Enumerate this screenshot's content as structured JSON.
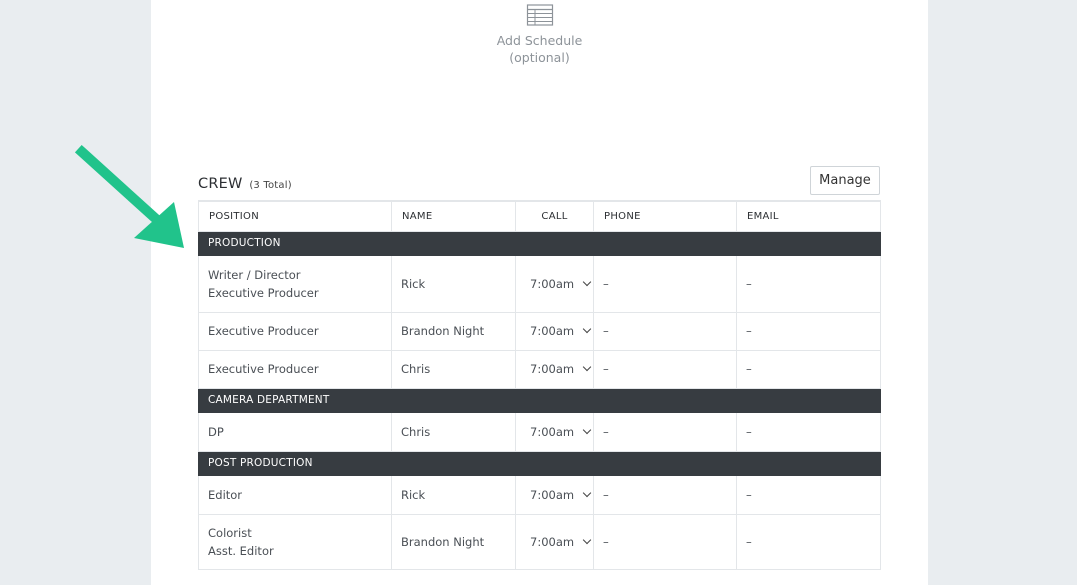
{
  "colors": {
    "page_background": "#e9edf0",
    "sheet_background": "#ffffff",
    "department_row": "#373c41",
    "arrow": "#21c38b"
  },
  "schedule": {
    "icon": "table-icon",
    "line1": "Add Schedule",
    "line2": "(optional)"
  },
  "crew": {
    "title": "CREW",
    "count": "(3 Total)",
    "manage_label": "Manage"
  },
  "table": {
    "columns": [
      "POSITION",
      "NAME",
      "CALL",
      "PHONE",
      "EMAIL"
    ],
    "departments": [
      {
        "name": "PRODUCTION",
        "rows": [
          {
            "position": [
              "Writer / Director",
              "Executive Producer"
            ],
            "name": "Rick",
            "call": "7:00am",
            "phone": "–",
            "email": "–"
          },
          {
            "position": [
              "Executive Producer"
            ],
            "name": "Brandon Night",
            "call": "7:00am",
            "phone": "–",
            "email": "–"
          },
          {
            "position": [
              "Executive Producer"
            ],
            "name": "Chris",
            "call": "7:00am",
            "phone": "–",
            "email": "–"
          }
        ]
      },
      {
        "name": "CAMERA DEPARTMENT",
        "rows": [
          {
            "position": [
              "DP"
            ],
            "name": "Chris",
            "call": "7:00am",
            "phone": "–",
            "email": "–"
          }
        ]
      },
      {
        "name": "POST PRODUCTION",
        "rows": [
          {
            "position": [
              "Editor"
            ],
            "name": "Rick",
            "call": "7:00am",
            "phone": "–",
            "email": "–"
          },
          {
            "position": [
              "Colorist",
              "Asst. Editor"
            ],
            "name": "Brandon Night",
            "call": "7:00am",
            "phone": "–",
            "email": "–"
          }
        ]
      }
    ]
  },
  "annotation": {
    "icon": "arrow-pointer-icon"
  }
}
